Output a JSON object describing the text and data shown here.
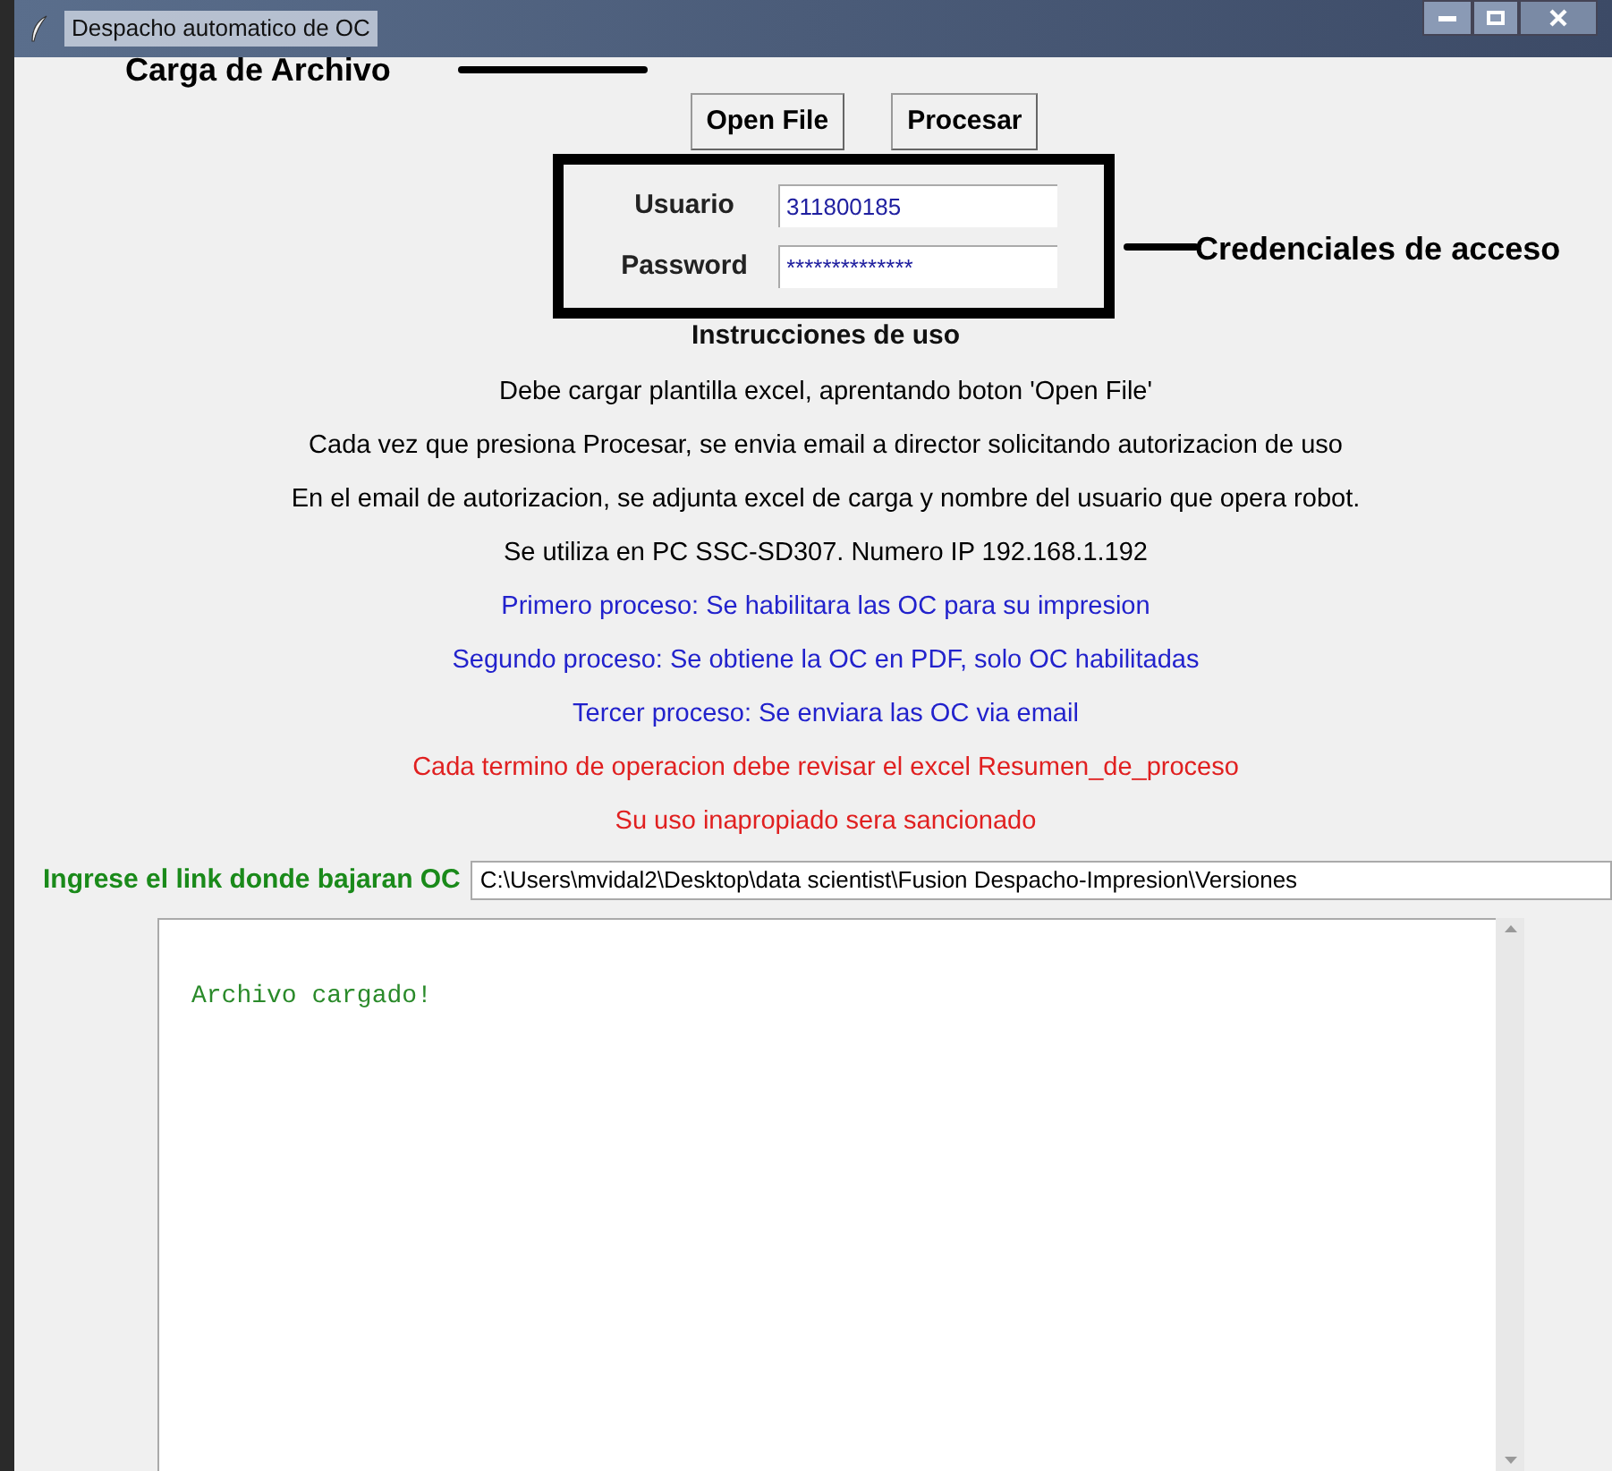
{
  "window": {
    "title": "Despacho automatico de OC"
  },
  "buttons": [
    "Open File",
    "Procesar"
  ],
  "credentials": [
    {
      "label": "Usuario",
      "value": "311800185"
    },
    {
      "label": "Password",
      "value": "**************"
    }
  ],
  "annotations": [
    "Carga de Archivo",
    "Credenciales de acceso"
  ],
  "instructions": {
    "title": "Instrucciones de uso",
    "lines": [
      {
        "text": "Debe cargar plantilla excel, aprentando boton 'Open File'",
        "color": "#000000"
      },
      {
        "text": "Cada vez que presiona Procesar, se envia email a director solicitando autorizacion de uso",
        "color": "#000000"
      },
      {
        "text": "En el email de autorizacion, se adjunta excel de carga y nombre del usuario que opera robot.",
        "color": "#000000"
      },
      {
        "text": "Se utiliza en PC SSC-SD307. Numero IP 192.168.1.192",
        "color": "#000000"
      },
      {
        "text": "Primero proceso: Se habilitara las OC para su impresion",
        "color": "#2222cc"
      },
      {
        "text": "Segundo proceso: Se obtiene la OC en PDF, solo OC habilitadas",
        "color": "#2222cc"
      },
      {
        "text": "Tercer proceso: Se enviara las OC via email",
        "color": "#2222cc"
      },
      {
        "text": "Cada termino de operacion debe revisar el excel Resumen_de_proceso",
        "color": "#e02020"
      },
      {
        "text": "Su uso inapropiado sera sancionado",
        "color": "#e02020"
      }
    ]
  },
  "link": {
    "label": "Ingrese el link donde bajaran OC",
    "value": "C:\\Users\\mvidal2\\Desktop\\data scientist\\Fusion Despacho-Impresion\\Versiones"
  },
  "log": {
    "text": "Archivo cargado!"
  }
}
